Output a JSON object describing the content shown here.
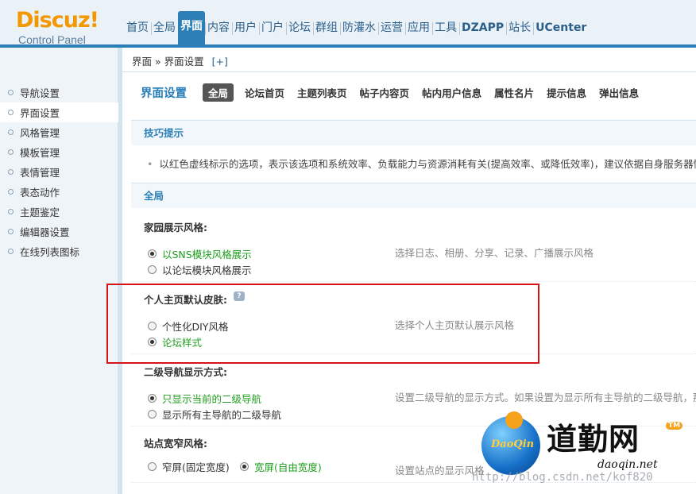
{
  "header": {
    "logo_title": "Discuz!",
    "logo_subtitle": "Control Panel",
    "nav": [
      {
        "label": "首页",
        "bold": false
      },
      {
        "label": "全局",
        "bold": false
      },
      {
        "label": "界面",
        "bold": true,
        "active": true
      },
      {
        "label": "内容",
        "bold": false
      },
      {
        "label": "用户",
        "bold": false
      },
      {
        "label": "门户",
        "bold": false
      },
      {
        "label": "论坛",
        "bold": false
      },
      {
        "label": "群组",
        "bold": false
      },
      {
        "label": "防灌水",
        "bold": false
      },
      {
        "label": "运营",
        "bold": false
      },
      {
        "label": "应用",
        "bold": false
      },
      {
        "label": "工具",
        "bold": false
      },
      {
        "label": "DZAPP",
        "bold": true
      },
      {
        "label": "站长",
        "bold": false
      },
      {
        "label": "UCenter",
        "bold": true
      }
    ]
  },
  "breadcrumb": {
    "path": "界面 » 界面设置",
    "add": "[+]"
  },
  "sidebar": {
    "items": [
      {
        "label": "导航设置",
        "active": false
      },
      {
        "label": "界面设置",
        "active": true
      },
      {
        "label": "风格管理",
        "active": false
      },
      {
        "label": "模板管理",
        "active": false
      },
      {
        "label": "表情管理",
        "active": false
      },
      {
        "label": "表态动作",
        "active": false
      },
      {
        "label": "主题鉴定",
        "active": false
      },
      {
        "label": "编辑器设置",
        "active": false
      },
      {
        "label": "在线列表图标",
        "active": false
      }
    ]
  },
  "main": {
    "title": "界面设置",
    "tabs": [
      {
        "label": "全局",
        "active": true
      },
      {
        "label": "论坛首页",
        "active": false
      },
      {
        "label": "主题列表页",
        "active": false
      },
      {
        "label": "帖子内容页",
        "active": false
      },
      {
        "label": "帖内用户信息",
        "active": false
      },
      {
        "label": "属性名片",
        "active": false
      },
      {
        "label": "提示信息",
        "active": false
      },
      {
        "label": "弹出信息",
        "active": false
      }
    ],
    "tips": {
      "heading": "技巧提示",
      "text": "以红色虚线标示的选项，表示该选项和系统效率、负载能力与资源消耗有关(提高效率、或降低效率)，建议依据自身服务器情况进"
    },
    "global_heading": "全局",
    "settings": [
      {
        "label": "家园展示风格:",
        "options": [
          {
            "label": "以SNS模块风格展示",
            "checked": true
          },
          {
            "label": "以论坛模块风格展示",
            "checked": false
          }
        ],
        "description": "选择日志、相册、分享、记录、广播展示风格"
      },
      {
        "label": "个人主页默认皮肤:",
        "help_icon": "?",
        "options": [
          {
            "label": "个性化DIY风格",
            "checked": false
          },
          {
            "label": "论坛样式",
            "checked": true
          }
        ],
        "description": "选择个人主页默认展示风格"
      },
      {
        "label": "二级导航显示方式:",
        "options": [
          {
            "label": "只显示当前的二级导航",
            "checked": true
          },
          {
            "label": "显示所有主导航的二级导航",
            "checked": false
          }
        ],
        "description": "设置二级导航的显示方式。如果设置为显示所有主导航的二级导航，那么"
      },
      {
        "label": "站点宽窄风格:",
        "options": [
          {
            "label": "窄屏(固定宽度)",
            "checked": false
          },
          {
            "label": "宽屏(自由宽度)",
            "checked": true
          }
        ],
        "description": "设置站点的显示风格"
      }
    ]
  },
  "watermark": {
    "logo_text": "DaoQin",
    "brand": "道勤网",
    "tm": "TM",
    "url": "daoqin.net",
    "blog": "http://blog.csdn.net/kof820"
  },
  "colors": {
    "accent": "#2b7fb6",
    "checked_text": "#1e9e1e",
    "annotation": "#d7141a",
    "logo_orange": "#f39800"
  }
}
